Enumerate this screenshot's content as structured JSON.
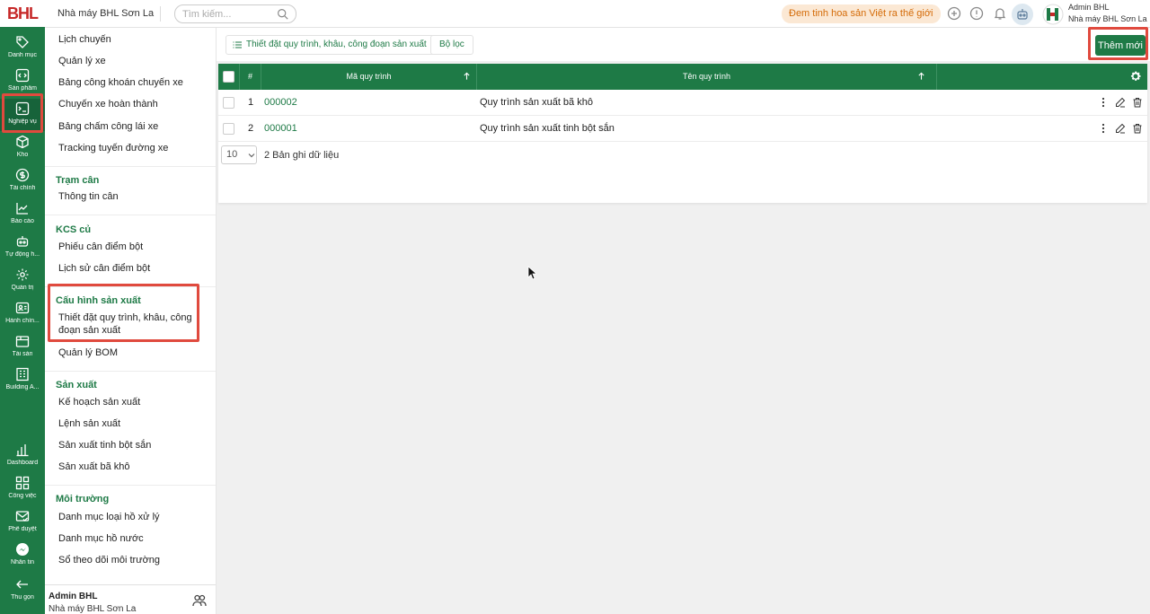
{
  "app": {
    "logo_text": "BHL",
    "factory_name": "Nhà máy BHL Sơn La",
    "search_placeholder": "Tìm kiếm...",
    "slogan": "Đem tinh hoa sản Việt ra thế giới"
  },
  "user": {
    "name": "Admin BHL",
    "factory": "Nhà máy BHL Sơn La"
  },
  "rail": {
    "items": [
      {
        "label": "Danh mục",
        "icon": "tag-icon"
      },
      {
        "label": "Sản phẩm",
        "icon": "code-icon"
      },
      {
        "label": "Nghiệp vụ",
        "icon": "terminal-icon"
      },
      {
        "label": "Kho",
        "icon": "box-icon"
      },
      {
        "label": "Tài chính",
        "icon": "dollar-icon"
      },
      {
        "label": "Báo cáo",
        "icon": "line-chart-icon"
      },
      {
        "label": "Tự động h...",
        "icon": "robot-icon"
      },
      {
        "label": "Quản trị",
        "icon": "gear-icon"
      },
      {
        "label": "Hành chín...",
        "icon": "id-card-icon"
      },
      {
        "label": "Tài sản",
        "icon": "package-icon"
      },
      {
        "label": "Building A...",
        "icon": "building-icon"
      }
    ],
    "bottom_items": [
      {
        "label": "Dashboard",
        "icon": "bar-chart-icon"
      },
      {
        "label": "Công việc",
        "icon": "grid-icon"
      },
      {
        "label": "Phê duyệt",
        "icon": "mail-check-icon"
      },
      {
        "label": "Nhắn tin",
        "icon": "messenger-icon"
      },
      {
        "label": "Thu gọn",
        "icon": "arrow-left-icon"
      }
    ],
    "active": "Nghiệp vụ"
  },
  "menu": {
    "top_items": [
      "Lịch chuyến",
      "Quản lý xe",
      "Bảng công khoán chuyến xe",
      "Chuyến xe hoàn thành",
      "Bảng chấm công lái xe",
      "Tracking tuyến đường xe"
    ],
    "groups": [
      {
        "title": "Trạm cân",
        "items": [
          "Thông tin cân"
        ]
      },
      {
        "title": "KCS củ",
        "items": [
          "Phiếu cân điểm bột",
          "Lịch sử cân điểm bột"
        ]
      },
      {
        "title": "Cấu hình sản xuất",
        "items": [
          "Thiết đặt quy trình, khâu, công",
          "đoạn sản xuất",
          "Quản lý BOM"
        ]
      },
      {
        "title": "Sản xuất",
        "items": [
          "Kế hoạch sản xuất",
          "Lệnh sản xuất",
          "Sản xuất tinh bột sắn",
          "Sản xuất bã khô"
        ]
      },
      {
        "title": "Môi trường",
        "items": [
          "Danh mục loại hồ xử lý",
          "Danh mục hồ nước",
          "Sổ theo dõi môi trường"
        ]
      }
    ]
  },
  "toolbar": {
    "tab_label": "Thiết đặt quy trình, khâu, công đoạn sản xuất",
    "filter_label": "Bộ lọc",
    "add_label": "Thêm mới"
  },
  "table": {
    "columns": {
      "index": "#",
      "code": "Mã quy trình",
      "name": "Tên quy trình"
    },
    "rows": [
      {
        "index": "1",
        "code": "000002",
        "name": "Quy trình sản xuất bã khô"
      },
      {
        "index": "2",
        "code": "000001",
        "name": "Quy trình sản xuất tinh bột sắn"
      }
    ],
    "page_size": "10",
    "record_count": "2 Bản ghi dữ liệu"
  },
  "colors": {
    "primary": "#1e7a46",
    "highlight": "#e04a3e",
    "slogan_bg": "#fbe8d4",
    "slogan_text": "#d46b08"
  }
}
